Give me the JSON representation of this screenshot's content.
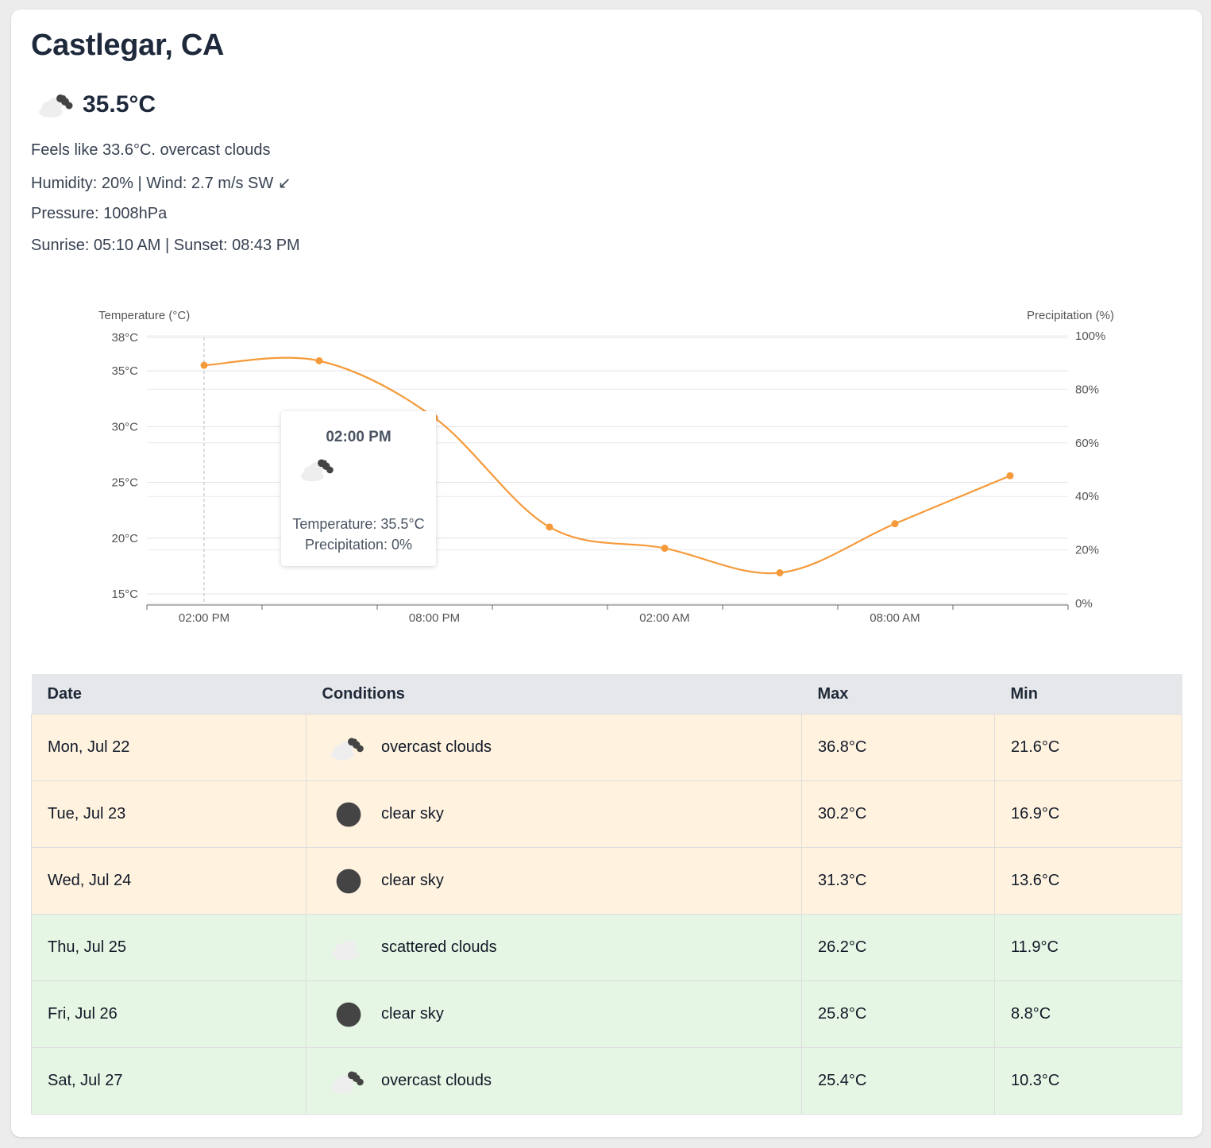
{
  "location": {
    "title": "Castlegar, CA"
  },
  "current": {
    "icon": "overcast-clouds-icon",
    "temperature": "35.5°C",
    "feels_like_line": "Feels like 33.6°C. overcast clouds",
    "humidity_wind_line": "Humidity: 20% | Wind: 2.7 m/s SW ↙",
    "pressure_line": "Pressure: 1008hPa",
    "sun_line": "Sunrise: 05:10 AM | Sunset: 08:43 PM"
  },
  "chart_data": {
    "type": "line",
    "ylabel": "Temperature (°C)",
    "y2label": "Precipitation (%)",
    "y_ticks": [
      "38°C",
      "35°C",
      "30°C",
      "25°C",
      "20°C",
      "15°C"
    ],
    "y2_ticks": [
      "100%",
      "80%",
      "60%",
      "40%",
      "20%",
      "0%"
    ],
    "x_tick_labels": [
      "02:00 PM",
      "08:00 PM",
      "02:00 AM",
      "08:00 AM"
    ],
    "ylim": [
      14,
      38
    ],
    "y2lim": [
      0,
      100
    ],
    "x": [
      "02:00 PM",
      "05:00 PM",
      "08:00 PM",
      "11:00 PM",
      "02:00 AM",
      "05:00 AM",
      "08:00 AM",
      "11:00 AM"
    ],
    "series": [
      {
        "values": [
          35.5,
          35.9,
          30.8,
          21.0,
          19.1,
          16.9,
          21.3,
          25.6
        ]
      }
    ],
    "color": "#f59a3a",
    "grid": true
  },
  "tooltip": {
    "time": "02:00 PM",
    "icon": "overcast-clouds-icon",
    "temperature_line": "Temperature: 35.5°C",
    "precipitation_line": "Precipitation: 0%"
  },
  "forecast": {
    "headers": [
      "Date",
      "Conditions",
      "Max",
      "Min"
    ],
    "rows": [
      {
        "date": "Mon, Jul 22",
        "icon": "overcast-clouds-icon",
        "conditions": "overcast clouds",
        "max": "36.8°C",
        "min": "21.6°C"
      },
      {
        "date": "Tue, Jul 23",
        "icon": "clear-sky-icon",
        "conditions": "clear sky",
        "max": "30.2°C",
        "min": "16.9°C"
      },
      {
        "date": "Wed, Jul 24",
        "icon": "clear-sky-icon",
        "conditions": "clear sky",
        "max": "31.3°C",
        "min": "13.6°C"
      },
      {
        "date": "Thu, Jul 25",
        "icon": "scattered-clouds-icon",
        "conditions": "scattered clouds",
        "max": "26.2°C",
        "min": "11.9°C"
      },
      {
        "date": "Fri, Jul 26",
        "icon": "clear-sky-icon",
        "conditions": "clear sky",
        "max": "25.8°C",
        "min": "8.8°C"
      },
      {
        "date": "Sat, Jul 27",
        "icon": "overcast-clouds-icon",
        "conditions": "overcast clouds",
        "max": "25.4°C",
        "min": "10.3°C"
      }
    ]
  },
  "colors": {
    "hot_row": "#fff3e0",
    "mild_row": "#e5f7e4",
    "header_bg": "#e5e7eb",
    "line": "#f59a3a"
  }
}
